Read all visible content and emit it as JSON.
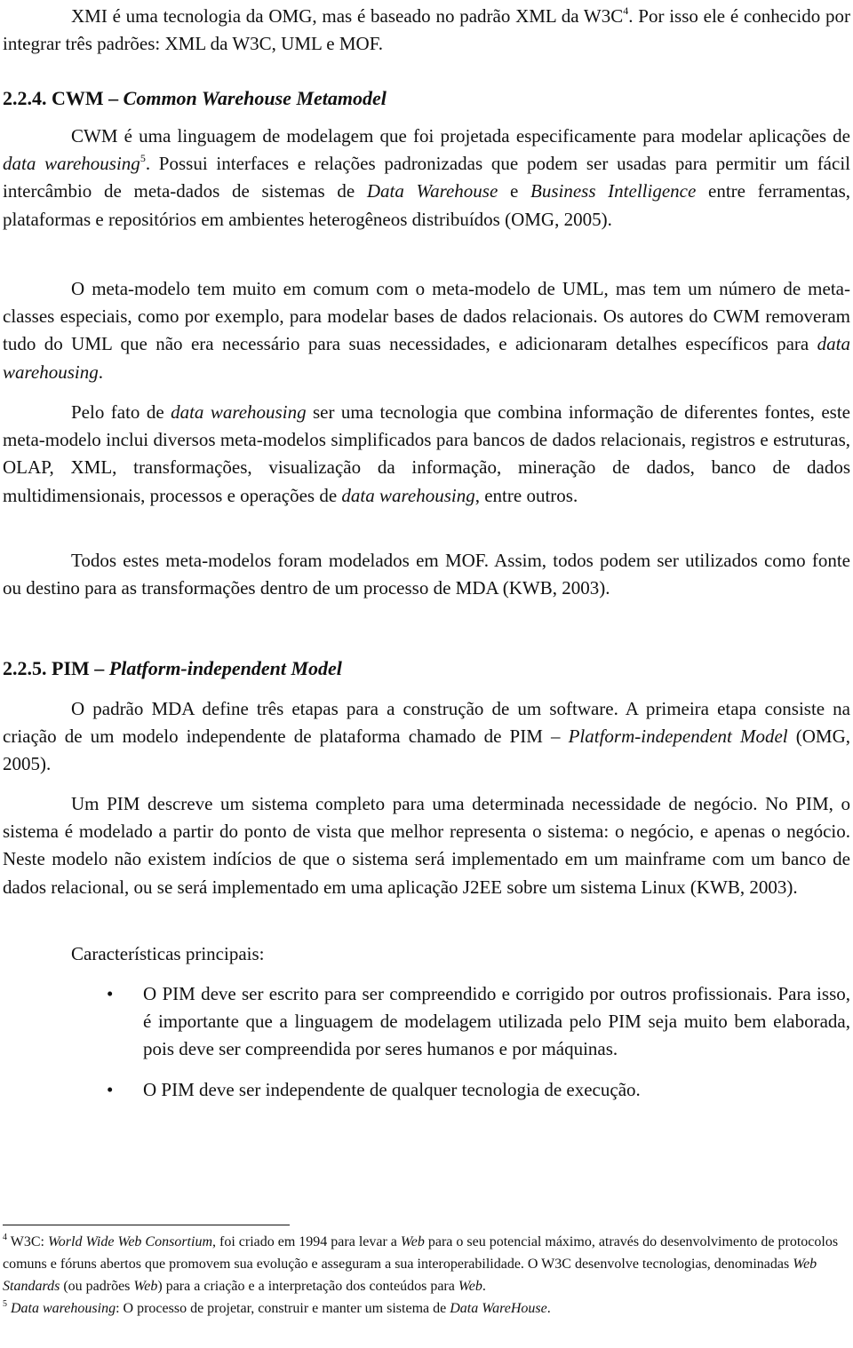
{
  "paragraphs": {
    "xmi": {
      "part1": "XMI é uma tecnologia da OMG, mas é baseado no padrão XML da W3C",
      "fnref": "4",
      "part2": ". Por isso ele é conhecido por integrar três padrões: XML da W3C, UML e MOF."
    },
    "sec224": {
      "number": "2.2.4. CWM – ",
      "title": "Common Warehouse Metamodel"
    },
    "cwm1": {
      "a": "CWM é uma linguagem de modelagem que foi projetada especificamente para modelar aplicações de ",
      "b_italic": "data warehousing",
      "fnref": "5",
      "c": ". Possui interfaces e relações padronizadas que podem ser usadas para permitir um fácil intercâmbio de meta-dados de sistemas de ",
      "d_italic": "Data Warehouse",
      "e": " e ",
      "f_italic": "Business Intelligence",
      "g": " entre ferramentas, plataformas e repositórios em ambientes heterogêneos distribuídos (OMG, 2005)."
    },
    "cwm2": {
      "a": "O meta-modelo tem muito em comum com o meta-modelo de UML, mas tem um número de meta-classes especiais, como por exemplo, para modelar bases de dados relacionais. Os autores do CWM removeram tudo do UML que não era necessário para suas necessidades, e adicionaram detalhes específicos para ",
      "b_italic": "data warehousing",
      "c": "."
    },
    "cwm3": {
      "a": "Pelo fato de ",
      "b_italic": "data warehousing",
      "c": " ser uma tecnologia que combina informação de diferentes fontes, este meta-modelo inclui diversos meta-modelos simplificados para bancos de dados relacionais, registros e estruturas, OLAP, XML, transformações, visualização da informação, mineração de dados, banco de dados multidimensionais, processos e operações de ",
      "d_italic": "data warehousing",
      "e": ", entre outros."
    },
    "cwm4": "Todos estes meta-modelos foram modelados em MOF. Assim, todos podem ser utilizados como fonte ou destino para as transformações dentro de um processo de MDA (KWB, 2003).",
    "sec225": {
      "number": "2.2.5. PIM – ",
      "title": "Platform-independent Model"
    },
    "pim1": {
      "a": "O padrão MDA define três etapas para a construção de um software. A primeira etapa consiste na criação de um modelo independente de plataforma chamado de PIM – ",
      "b_italic": "Platform-independent Model",
      "c": " (OMG, 2005)."
    },
    "pim2": "Um PIM descreve um sistema completo para uma determinada necessidade de negócio. No PIM, o sistema é modelado a partir do ponto de vista que melhor representa o sistema: o negócio, e apenas o negócio. Neste modelo não existem indícios de que o sistema será implementado em um mainframe com um banco de dados relacional, ou se será implementado em uma aplicação J2EE sobre um sistema Linux (KWB, 2003).",
    "characteristics_label": "Características principais:",
    "bullets": [
      "O PIM deve ser escrito para ser compreendido e corrigido por outros profissionais. Para isso, é importante que a linguagem de modelagem utilizada pelo PIM seja muito bem elaborada, pois deve ser compreendida por seres humanos e por máquinas.",
      "O PIM deve ser independente de qualquer tecnologia de execução."
    ],
    "bullet_glyph": "•"
  },
  "footnotes": {
    "fn4": {
      "mark": "4",
      "a": " W3C: ",
      "b_italic": "World Wide Web Consortium",
      "c": ", foi criado em 1994 para levar a ",
      "d_italic": "Web",
      "e": " para o seu potencial máximo, através do desenvolvimento de protocolos comuns e fóruns abertos que promovem sua evolução e asseguram a sua interoperabilidade. O W3C desenvolve tecnologias, denominadas ",
      "f_italic": "Web Standards",
      "g": " (ou padrões ",
      "h_italic": "Web",
      "i": ") para a criação e a interpretação dos conteúdos para ",
      "j_italic": "Web",
      "k": "."
    },
    "fn5": {
      "mark": "5",
      "a_italic": " Data warehousing",
      "b": ": O processo de projetar, construir e manter um sistema de ",
      "c_italic": "Data WareHouse",
      "d": "."
    }
  }
}
